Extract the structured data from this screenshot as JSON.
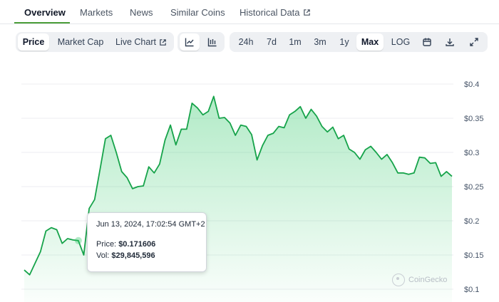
{
  "tabs": [
    {
      "label": "Overview",
      "active": true
    },
    {
      "label": "Markets",
      "active": false
    },
    {
      "label": "News",
      "active": false
    },
    {
      "label": "Similar Coins",
      "active": false
    },
    {
      "label": "Historical Data",
      "active": false,
      "external": true
    }
  ],
  "metric_toggle": [
    {
      "label": "Price",
      "active": true
    },
    {
      "label": "Market Cap",
      "active": false
    },
    {
      "label": "Live Chart",
      "active": false,
      "external": true
    }
  ],
  "chart_style_toggle": [
    {
      "icon": "line-chart-icon",
      "active": true
    },
    {
      "icon": "candlestick-chart-icon",
      "active": false
    }
  ],
  "range_toggle": [
    {
      "label": "24h",
      "active": false
    },
    {
      "label": "7d",
      "active": false
    },
    {
      "label": "1m",
      "active": false
    },
    {
      "label": "3m",
      "active": false
    },
    {
      "label": "1y",
      "active": false
    },
    {
      "label": "Max",
      "active": true
    },
    {
      "label": "LOG",
      "active": false
    }
  ],
  "toolbar_icons": [
    "calendar-icon",
    "download-icon",
    "expand-icon"
  ],
  "tooltip": {
    "date": "Jun 13, 2024, 17:02:54 GMT+2",
    "price_label": "Price:",
    "price_value": "$0.171606",
    "vol_label": "Vol:",
    "vol_value": "$29,845,596"
  },
  "watermark": "CoinGecko",
  "colors": {
    "line": "#16a34a",
    "fill": "#22c55e",
    "active_tab": "#4b9e3a"
  },
  "chart_data": {
    "type": "area",
    "title": "",
    "xlabel": "",
    "ylabel": "",
    "y_tick_labels": [
      "$0.4",
      "$0.35",
      "$0.3",
      "$0.25",
      "$0.2",
      "$0.15",
      "$0.1"
    ],
    "y_ticks": [
      0.4,
      0.35,
      0.3,
      0.25,
      0.2,
      0.15,
      0.1
    ],
    "ylim": [
      0.1,
      0.42
    ],
    "grid": true,
    "hover_index": 10,
    "values": [
      0.128,
      0.121,
      0.138,
      0.155,
      0.185,
      0.19,
      0.187,
      0.167,
      0.174,
      0.172,
      0.171,
      0.15,
      0.218,
      0.231,
      0.275,
      0.32,
      0.325,
      0.3,
      0.272,
      0.263,
      0.247,
      0.25,
      0.251,
      0.279,
      0.27,
      0.283,
      0.318,
      0.34,
      0.311,
      0.334,
      0.334,
      0.372,
      0.365,
      0.355,
      0.36,
      0.382,
      0.35,
      0.351,
      0.343,
      0.325,
      0.34,
      0.338,
      0.326,
      0.289,
      0.31,
      0.325,
      0.328,
      0.338,
      0.336,
      0.355,
      0.36,
      0.367,
      0.35,
      0.363,
      0.353,
      0.338,
      0.33,
      0.337,
      0.32,
      0.325,
      0.305,
      0.3,
      0.29,
      0.304,
      0.309,
      0.3,
      0.29,
      0.297,
      0.285,
      0.27,
      0.27,
      0.268,
      0.27,
      0.293,
      0.292,
      0.284,
      0.285,
      0.265,
      0.272,
      0.265
    ]
  }
}
